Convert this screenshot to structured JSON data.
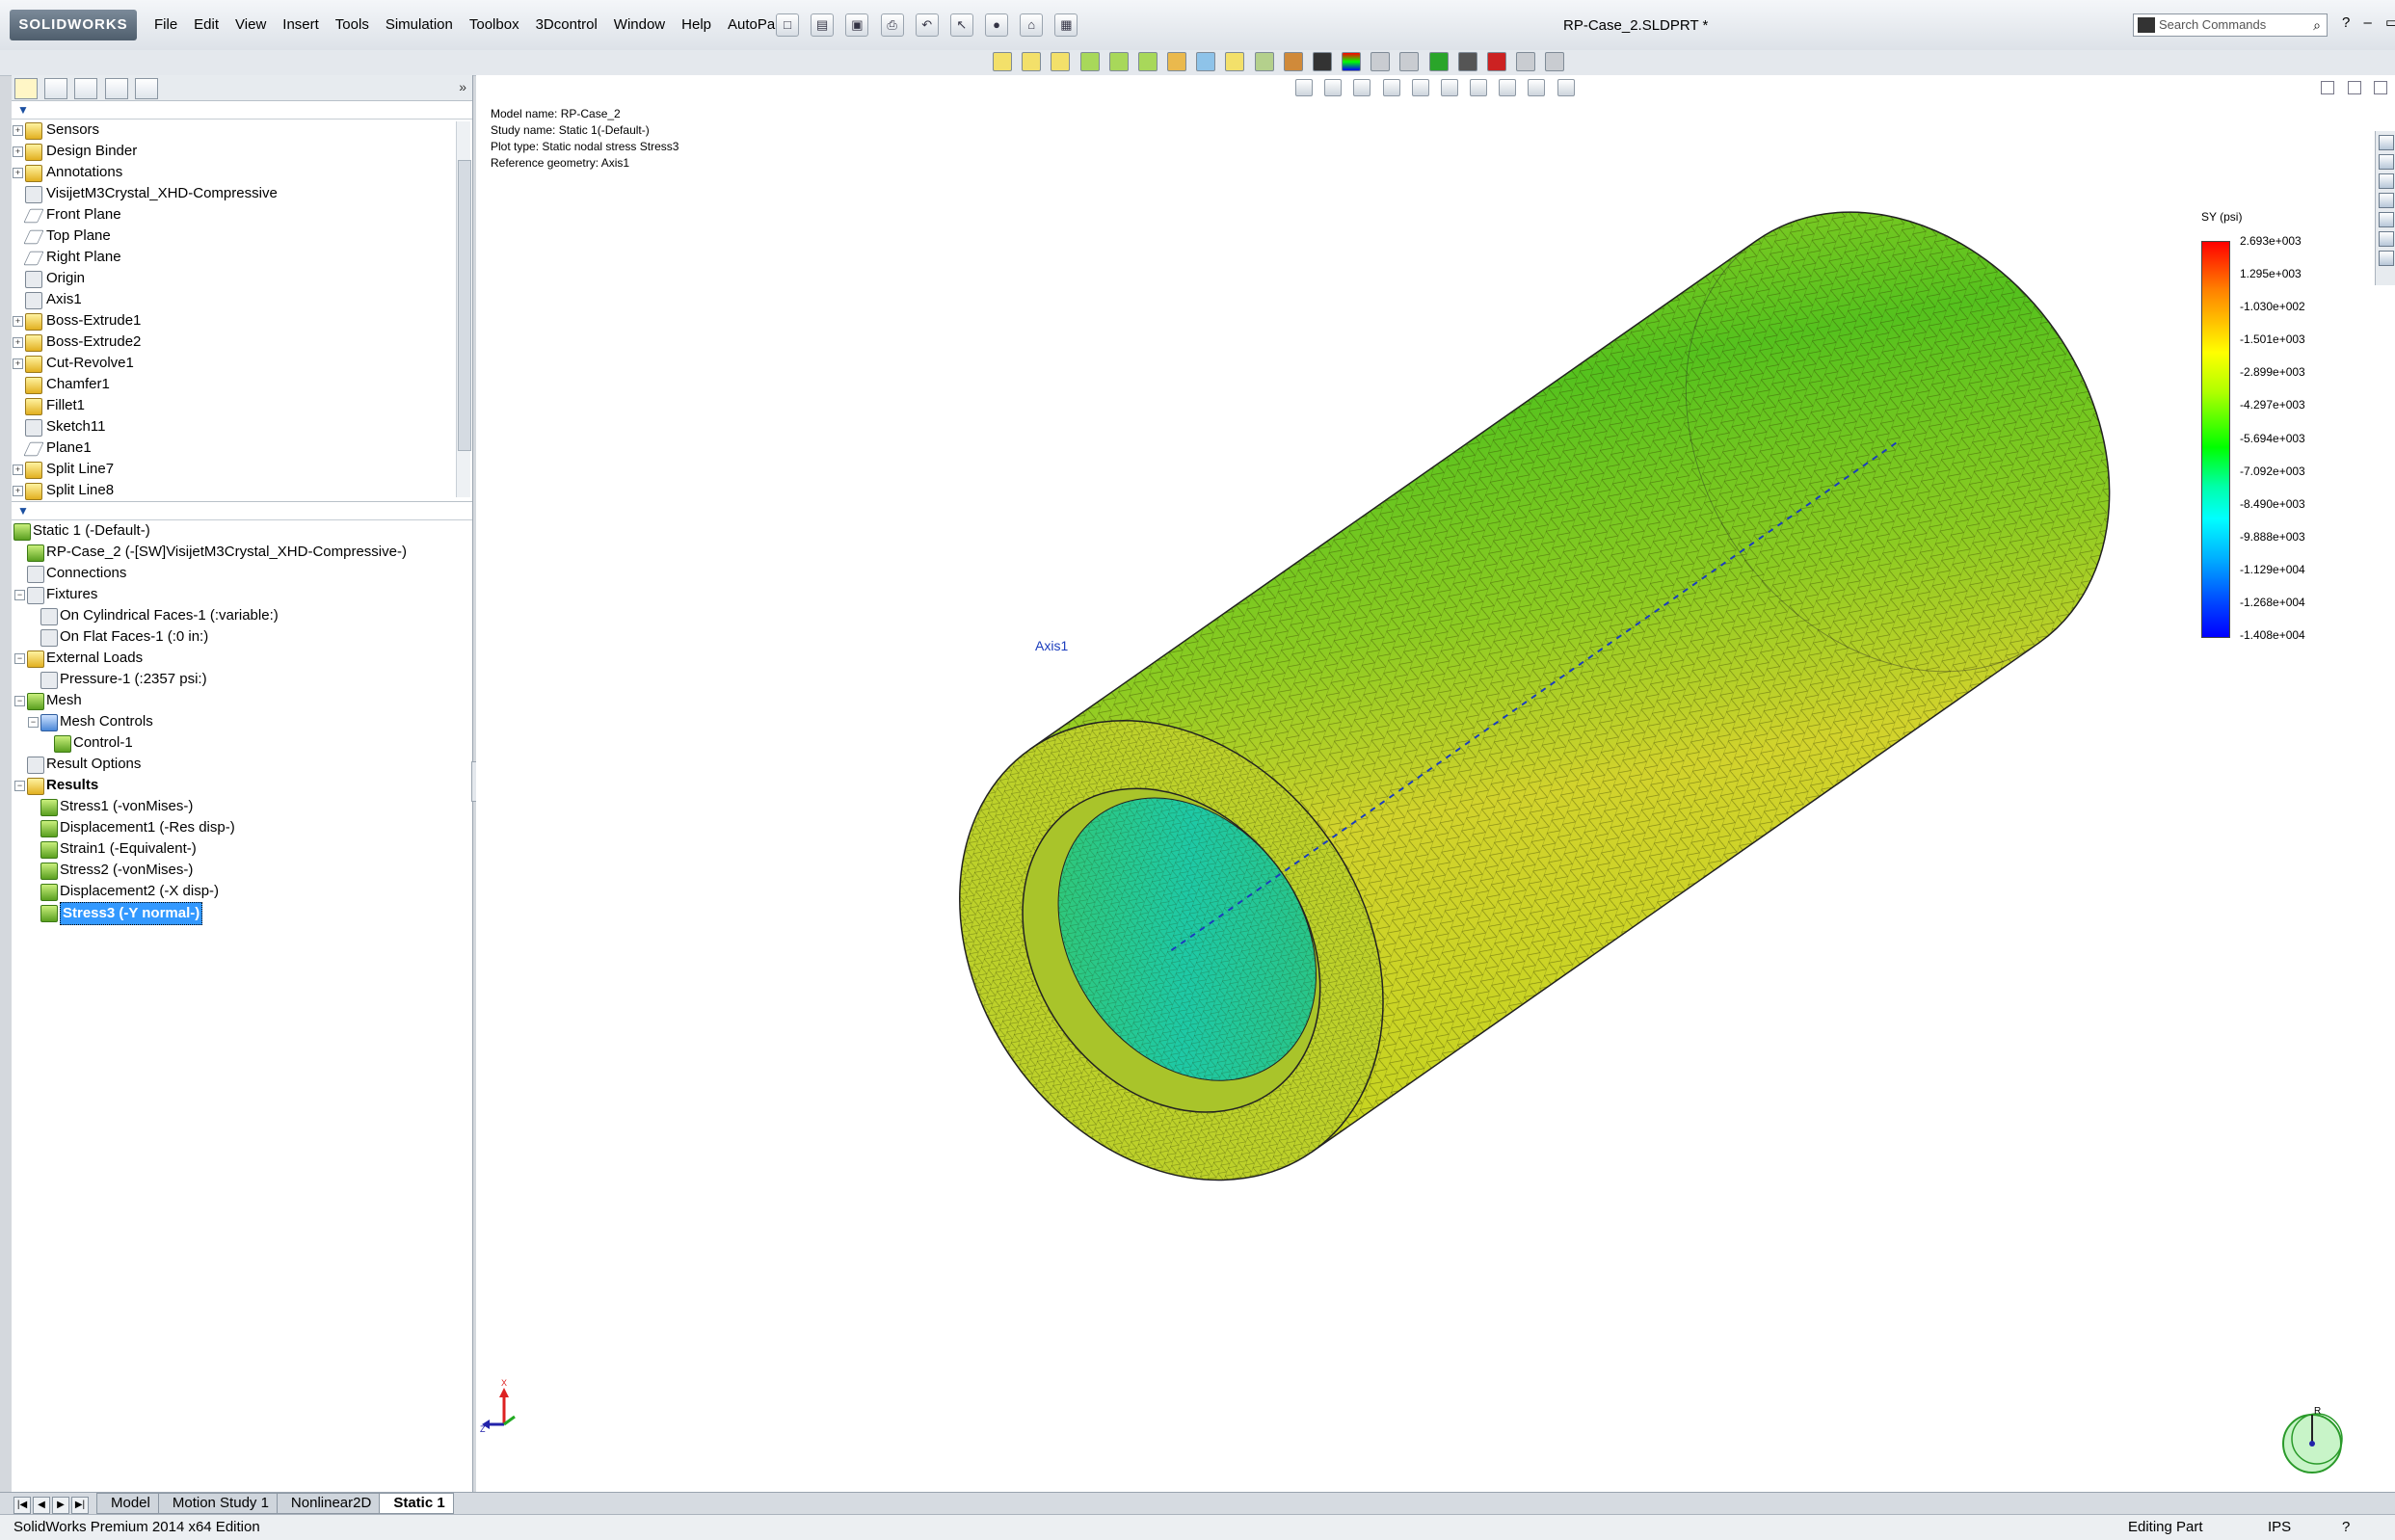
{
  "app": {
    "brand": "SOLIDWORKS",
    "doc_title": "RP-Case_2.SLDPRT *"
  },
  "menu": [
    "File",
    "Edit",
    "View",
    "Insert",
    "Tools",
    "Simulation",
    "Toolbox",
    "3Dcontrol",
    "Window",
    "Help",
    "AutoPart"
  ],
  "search": {
    "placeholder": "Search Commands"
  },
  "feature_tree": [
    {
      "label": "Sensors",
      "icon": "sensor-icon",
      "expand": true,
      "kind": "y"
    },
    {
      "label": "Design Binder",
      "icon": "design-binder-icon",
      "expand": true,
      "kind": "y"
    },
    {
      "label": "Annotations",
      "icon": "annotations-icon",
      "expand": true,
      "kind": "y"
    },
    {
      "label": "VisijetM3Crystal_XHD-Compressive",
      "icon": "material-icon",
      "expand": false,
      "kind": "gray"
    },
    {
      "label": "Front Plane",
      "icon": "plane-icon",
      "expand": false,
      "kind": "plane"
    },
    {
      "label": "Top Plane",
      "icon": "plane-icon",
      "expand": false,
      "kind": "plane"
    },
    {
      "label": "Right Plane",
      "icon": "plane-icon",
      "expand": false,
      "kind": "plane"
    },
    {
      "label": "Origin",
      "icon": "origin-icon",
      "expand": false,
      "kind": "gray"
    },
    {
      "label": "Axis1",
      "icon": "axis-icon",
      "expand": false,
      "kind": "gray"
    },
    {
      "label": "Boss-Extrude1",
      "icon": "extrude-icon",
      "expand": true,
      "kind": "y"
    },
    {
      "label": "Boss-Extrude2",
      "icon": "extrude-icon",
      "expand": true,
      "kind": "y"
    },
    {
      "label": "Cut-Revolve1",
      "icon": "revolve-icon",
      "expand": true,
      "kind": "y"
    },
    {
      "label": "Chamfer1",
      "icon": "chamfer-icon",
      "expand": false,
      "kind": "y"
    },
    {
      "label": "Fillet1",
      "icon": "fillet-icon",
      "expand": false,
      "kind": "y"
    },
    {
      "label": "Sketch11",
      "icon": "sketch-icon",
      "expand": false,
      "kind": "gray"
    },
    {
      "label": "Plane1",
      "icon": "plane-icon",
      "expand": false,
      "kind": "plane"
    },
    {
      "label": "Split Line7",
      "icon": "split-line-icon",
      "expand": true,
      "kind": "y"
    },
    {
      "label": "Split Line8",
      "icon": "split-line-icon",
      "expand": true,
      "kind": "y"
    }
  ],
  "sim_tree": [
    {
      "label": "Static 1 (-Default-)",
      "indent": 0,
      "expand": false,
      "icon": "study-icon",
      "kind": "g",
      "bold": false
    },
    {
      "label": "RP-Case_2 (-[SW]VisijetM3Crystal_XHD-Compressive-)",
      "indent": 1,
      "expand": false,
      "icon": "part-icon",
      "kind": "g",
      "bold": false
    },
    {
      "label": "Connections",
      "indent": 1,
      "expand": false,
      "icon": "connections-icon",
      "kind": "gray",
      "bold": false
    },
    {
      "label": "Fixtures",
      "indent": 1,
      "expand": true,
      "icon": "fixture-icon",
      "kind": "gray",
      "bold": false
    },
    {
      "label": "On Cylindrical Faces-1 (:variable:)",
      "indent": 2,
      "expand": false,
      "icon": "cylindrical-face-icon",
      "kind": "gray",
      "bold": false
    },
    {
      "label": "On Flat Faces-1 (:0 in:)",
      "indent": 2,
      "expand": false,
      "icon": "flat-face-icon",
      "kind": "gray",
      "bold": false
    },
    {
      "label": "External Loads",
      "indent": 1,
      "expand": true,
      "icon": "load-icon",
      "kind": "y",
      "bold": false
    },
    {
      "label": "Pressure-1 (:2357 psi:)",
      "indent": 2,
      "expand": false,
      "icon": "pressure-icon",
      "kind": "gray",
      "bold": false
    },
    {
      "label": "Mesh",
      "indent": 1,
      "expand": true,
      "icon": "mesh-icon",
      "kind": "g",
      "bold": false
    },
    {
      "label": "Mesh Controls",
      "indent": 2,
      "expand": true,
      "icon": "mesh-controls-icon",
      "kind": "b",
      "bold": false
    },
    {
      "label": "Control-1",
      "indent": 3,
      "expand": false,
      "icon": "mesh-control-icon",
      "kind": "g",
      "bold": false
    },
    {
      "label": "Result Options",
      "indent": 1,
      "expand": false,
      "icon": "result-options-icon",
      "kind": "gray",
      "bold": false
    },
    {
      "label": "Results",
      "indent": 1,
      "expand": true,
      "icon": "results-icon",
      "kind": "y",
      "bold": true
    },
    {
      "label": "Stress1 (-vonMises-)",
      "indent": 2,
      "expand": false,
      "icon": "plot-icon",
      "kind": "g",
      "bold": false
    },
    {
      "label": "Displacement1 (-Res disp-)",
      "indent": 2,
      "expand": false,
      "icon": "plot-icon",
      "kind": "g",
      "bold": false
    },
    {
      "label": "Strain1 (-Equivalent-)",
      "indent": 2,
      "expand": false,
      "icon": "plot-icon",
      "kind": "g",
      "bold": false
    },
    {
      "label": "Stress2 (-vonMises-)",
      "indent": 2,
      "expand": false,
      "icon": "plot-icon",
      "kind": "g",
      "bold": false
    },
    {
      "label": "Displacement2 (-X disp-)",
      "indent": 2,
      "expand": false,
      "icon": "plot-icon",
      "kind": "g",
      "bold": false
    },
    {
      "label": "Stress3 (-Y normal-)",
      "indent": 2,
      "expand": false,
      "icon": "plot-icon",
      "kind": "g",
      "bold": false,
      "selected": true
    }
  ],
  "viewport_info": {
    "model_name": "Model name: RP-Case_2",
    "study_name": "Study name: Static 1(-Default-)",
    "plot_type": "Plot type: Static nodal stress Stress3",
    "reference": "Reference geometry: Axis1"
  },
  "legend": {
    "title": "SY (psi)",
    "ticks": [
      "2.693e+003",
      "1.295e+003",
      "-1.030e+002",
      "-1.501e+003",
      "-2.899e+003",
      "-4.297e+003",
      "-5.694e+003",
      "-7.092e+003",
      "-8.490e+003",
      "-9.888e+003",
      "-1.129e+004",
      "-1.268e+004",
      "-1.408e+004"
    ]
  },
  "axis_label": "Axis1",
  "triad": {
    "x": "X",
    "z": "Z"
  },
  "orientation": {
    "label": "R"
  },
  "bottom_tabs": [
    {
      "label": "Model",
      "active": false
    },
    {
      "label": "Motion Study 1",
      "active": false
    },
    {
      "label": "Nonlinear2D",
      "active": false
    },
    {
      "label": "Static 1",
      "active": true
    }
  ],
  "status": {
    "edition": "SolidWorks Premium 2014 x64 Edition",
    "mode": "Editing Part",
    "units": "IPS"
  }
}
